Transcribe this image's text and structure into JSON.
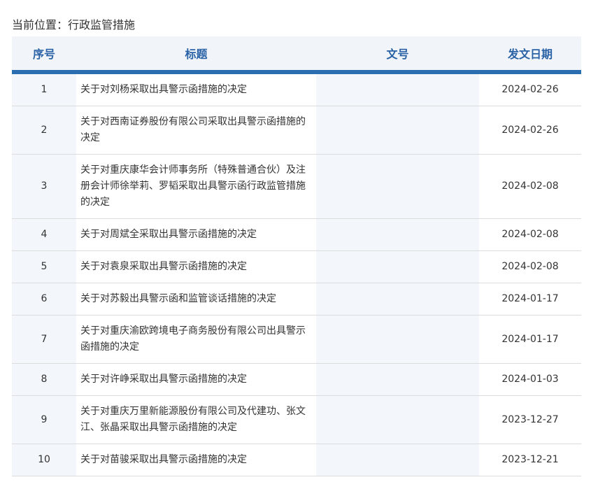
{
  "breadcrumb": "当前位置：行政监管措施",
  "headers": [
    "序号",
    "标题",
    "文号",
    "发文日期"
  ],
  "rows": [
    {
      "no": "1",
      "title": "关于对刘杨采取出具警示函措施的决定",
      "doc": "",
      "date": "2024-02-26"
    },
    {
      "no": "2",
      "title": "关于对西南证券股份有限公司采取出具警示函措施的决定",
      "doc": "",
      "date": "2024-02-26"
    },
    {
      "no": "3",
      "title": "关于对重庆康华会计师事务所（特殊普通合伙）及注册会计师徐举莉、罗韬采取出具警示函行政监管措施的决定",
      "doc": "",
      "date": "2024-02-08"
    },
    {
      "no": "4",
      "title": "关于对周斌全采取出具警示函措施的决定",
      "doc": "",
      "date": "2024-02-08"
    },
    {
      "no": "5",
      "title": "关于对袁泉采取出具警示函措施的决定",
      "doc": "",
      "date": "2024-02-08"
    },
    {
      "no": "6",
      "title": "关于对苏毅出具警示函和监管谈话措施的决定",
      "doc": "",
      "date": "2024-01-17"
    },
    {
      "no": "7",
      "title": "关于对重庆渝欧跨境电子商务股份有限公司出具警示函措施的决定",
      "doc": "",
      "date": "2024-01-17"
    },
    {
      "no": "8",
      "title": "关于对许峥采取出具警示函措施的决定",
      "doc": "",
      "date": "2024-01-03"
    },
    {
      "no": "9",
      "title": "关于对重庆万里新能源股份有限公司及代建功、张文江、张晶采取出具警示函措施的决定",
      "doc": "",
      "date": "2023-12-27"
    },
    {
      "no": "10",
      "title": "关于对苗骏采取出具警示函措施的决定",
      "doc": "",
      "date": "2023-12-21"
    }
  ]
}
